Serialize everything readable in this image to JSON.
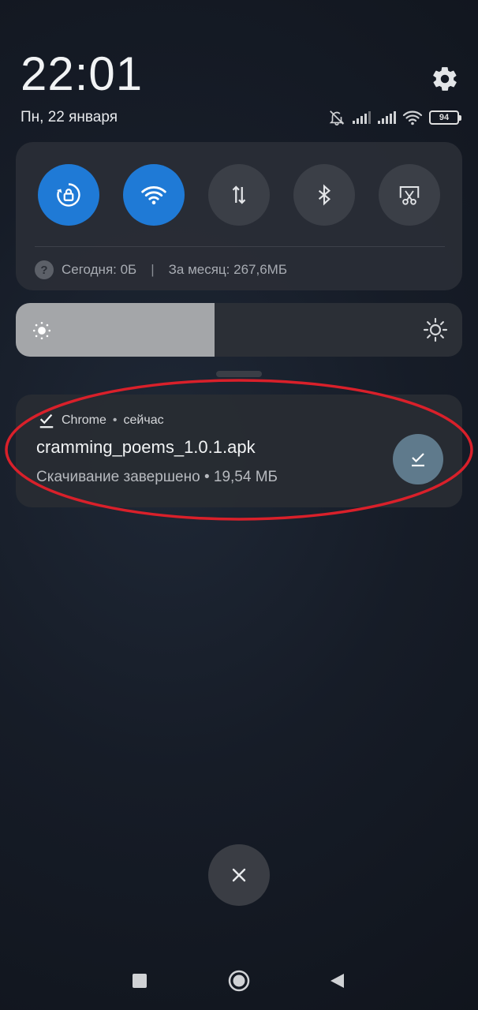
{
  "status_bar": {
    "time": "22:01",
    "date": "Пн, 22 января",
    "battery": "94",
    "icons": [
      "settings-gear-icon",
      "alarm-off-bell-icon",
      "signal-bars-icon",
      "signal-bars-icon",
      "wifi-icon",
      "battery-icon"
    ]
  },
  "quick_settings": {
    "tiles": [
      {
        "name": "auto-rotate-lock",
        "icon": "rotate-lock-icon",
        "active": true
      },
      {
        "name": "wifi",
        "icon": "wifi-icon",
        "active": true
      },
      {
        "name": "mobile-data",
        "icon": "data-transfer-arrows-icon",
        "active": false
      },
      {
        "name": "bluetooth",
        "icon": "bluetooth-icon",
        "active": false
      },
      {
        "name": "screenshot",
        "icon": "screenshot-scissors-icon",
        "active": false
      }
    ],
    "data_usage": {
      "today": "Сегодня: 0Б",
      "separator": "|",
      "month": "За месяц: 267,6МБ"
    }
  },
  "brightness": {
    "level": 0.445
  },
  "notification": {
    "app": "Chrome",
    "dot": "•",
    "time": "сейчас",
    "title": "cramming_poems_1.0.1.apk",
    "text": "Скачивание завершено • 19,54 МБ",
    "action_icon": "download-done-icon"
  },
  "colors": {
    "accent_active": "#1f7ad6",
    "highlight_annotation": "#d9202a"
  },
  "nav_bar": {
    "buttons": [
      "recents-square-icon",
      "home-circle-icon",
      "back-triangle-icon"
    ]
  }
}
